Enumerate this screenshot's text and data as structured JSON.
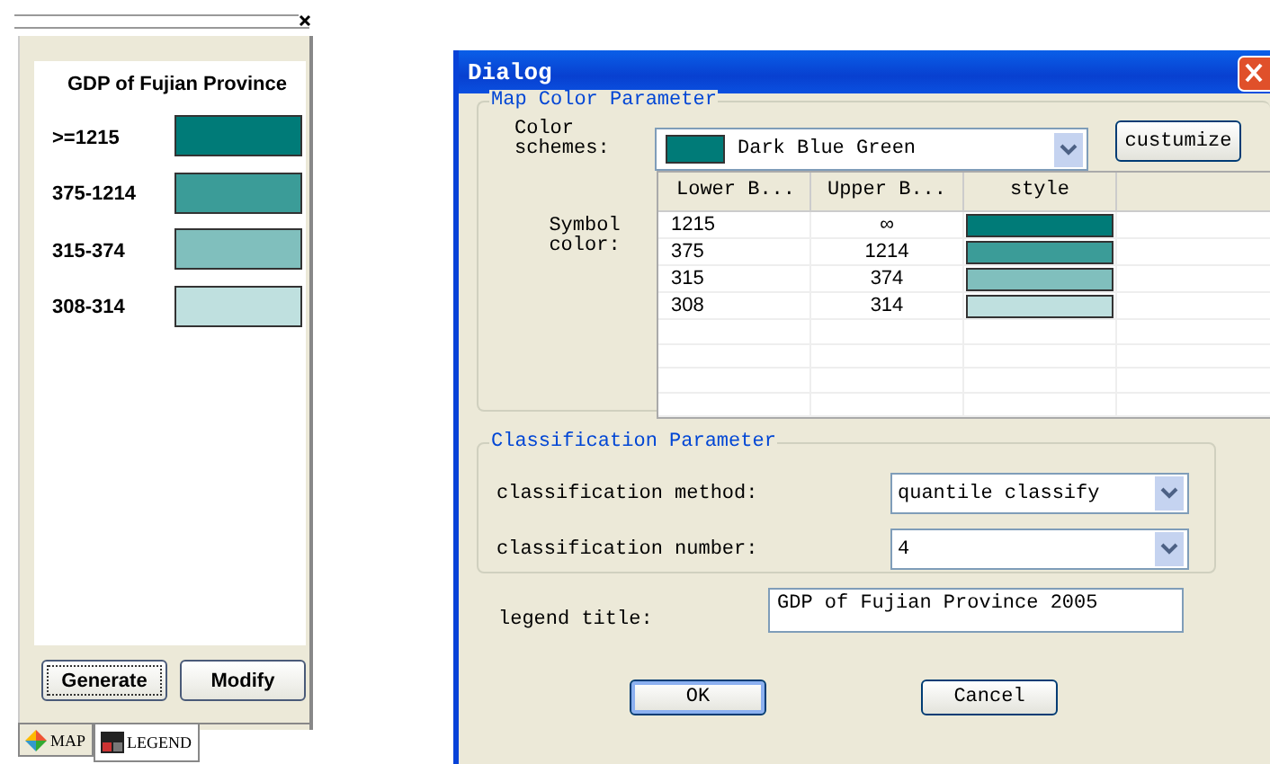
{
  "legend_panel": {
    "title": "GDP of Fujian Province",
    "items": [
      {
        "label": ">=1215",
        "color": "#007b78"
      },
      {
        "label": "375-1214",
        "color": "#3b9c98"
      },
      {
        "label": "315-374",
        "color": "#80bfbd"
      },
      {
        "label": "308-314",
        "color": "#bfe0df"
      }
    ],
    "buttons": [
      {
        "label": "Generate",
        "focused": true
      },
      {
        "label": "Modify",
        "focused": false
      }
    ],
    "tabs": [
      {
        "label": "MAP",
        "kind": "map",
        "selected": false
      },
      {
        "label": "LEGEND",
        "kind": "legend",
        "selected": true
      }
    ]
  },
  "dialog": {
    "title": "Dialog",
    "color_group": {
      "title": "Map Color Parameter",
      "scheme_label": "Color schemes:",
      "scheme": {
        "value": "Dark Blue Green",
        "color": "#007b78"
      },
      "customize_button": "custumize",
      "symbol_label": "Symbol color:",
      "table": {
        "columns": [
          "Lower B...",
          "Upper B...",
          "style"
        ],
        "rows": [
          {
            "lower": "1215",
            "upper": "∞",
            "color": "#007b78"
          },
          {
            "lower": "375",
            "upper": "1214",
            "color": "#3b9c98"
          },
          {
            "lower": "315",
            "upper": "374",
            "color": "#80bfbd"
          },
          {
            "lower": "308",
            "upper": "314",
            "color": "#bfe0df"
          }
        ]
      }
    },
    "classification": {
      "title": "Classification Parameter",
      "method_label": "classification method:",
      "method": "quantile classify",
      "number_label": "classification number:",
      "number": "4"
    },
    "legend_title_label": "legend title:",
    "legend_title": "GDP of Fujian Province 2005",
    "buttons": [
      {
        "label": "OK",
        "focused": true
      },
      {
        "label": "Cancel",
        "focused": false
      }
    ]
  }
}
